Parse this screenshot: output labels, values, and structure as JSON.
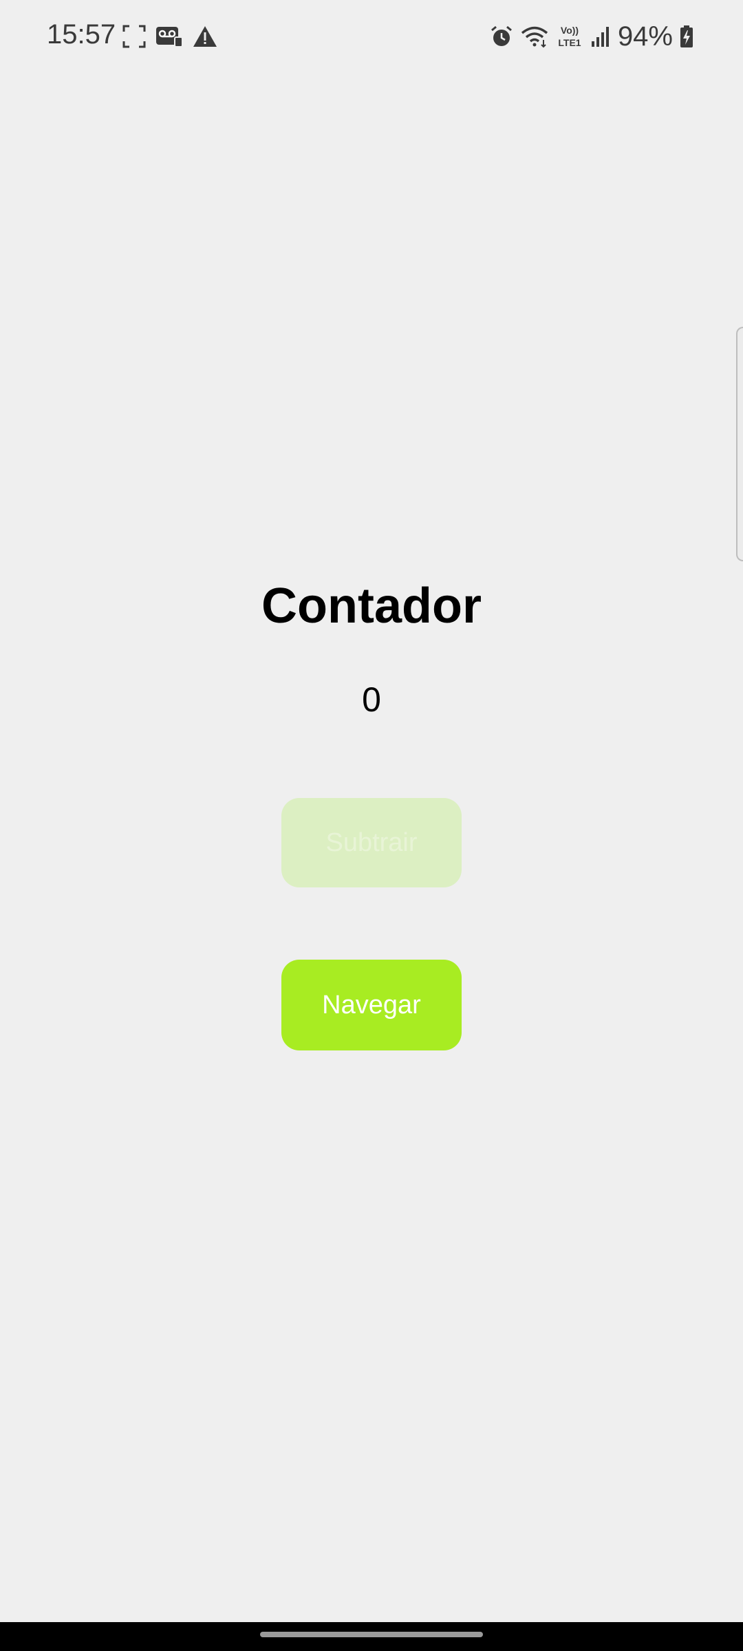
{
  "status_bar": {
    "time": "15:57",
    "battery": "94%",
    "left_icons": [
      "screenshot-frame-icon",
      "voicemail-icon",
      "warning-icon"
    ],
    "right_icons": [
      "alarm-icon",
      "wifi-icon",
      "volte-lte-icon",
      "signal-icon",
      "battery-charging-icon"
    ],
    "volte_label": "Vo)) LTE1"
  },
  "main": {
    "title": "Contador",
    "counter_value": "0",
    "subtract_button_label": "Subtrair",
    "navigate_button_label": "Navegar"
  },
  "colors": {
    "background": "#efefef",
    "primary_button": "#a8ec22",
    "disabled_button": "#dcefc2"
  }
}
